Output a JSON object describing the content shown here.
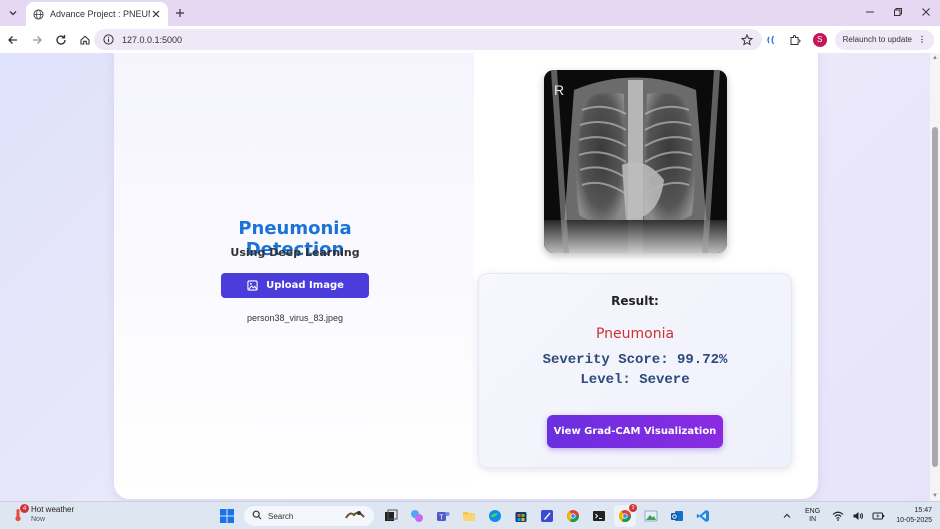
{
  "browser": {
    "tab_title": "Advance Project : PNEUMONIA",
    "url": "127.0.0.1:5000",
    "profile_initial": "S",
    "relaunch_label": "Relaunch to update"
  },
  "app": {
    "title": "Pneumonia Detection",
    "subtitle": "Using Deep Learning",
    "upload_label": "Upload Image",
    "filename": "person38_virus_83.jpeg",
    "xray_marker": "R",
    "result": {
      "label": "Result:",
      "prediction": "Pneumonia",
      "severity_line": "Severity Score: 99.72%",
      "level_line": "Level: Severe",
      "gradcam_label": "View Grad-CAM Visualization"
    }
  },
  "taskbar": {
    "weather_title": "Hot weather",
    "weather_sub": "Now",
    "weather_badge": "4",
    "search_placeholder": "Search",
    "chrome_badge": "3",
    "lang_top": "ENG",
    "lang_bottom": "IN",
    "time": "15:47",
    "date": "10-05-2025"
  },
  "colors": {
    "title_blue": "#1a73d9",
    "upload_btn": "#4b3ddb",
    "prediction_red": "#d0312d",
    "severity_text": "#2b4a7a",
    "gradcam_purple": "#8a2be2"
  }
}
